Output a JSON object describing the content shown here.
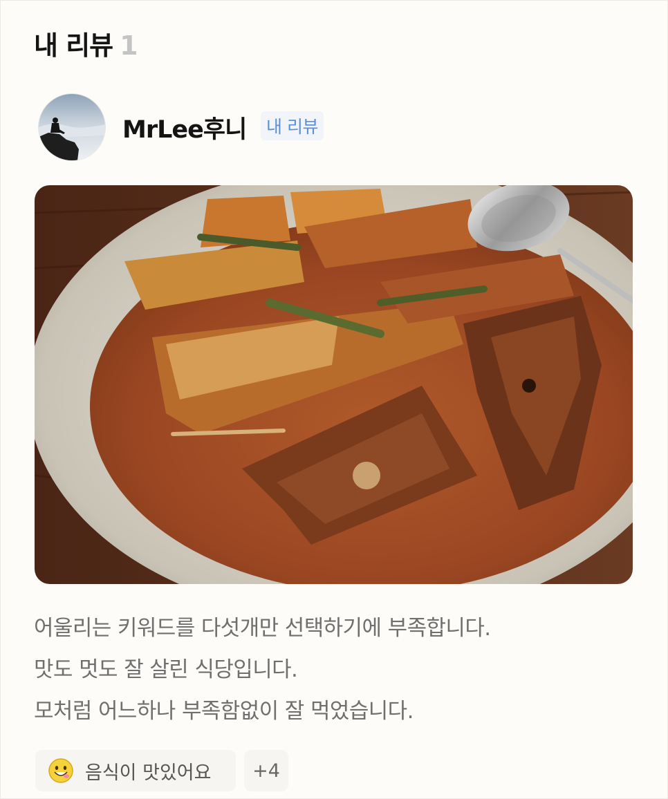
{
  "section": {
    "title": "내 리뷰",
    "count": "1"
  },
  "reviewer": {
    "name": "MrLee후니",
    "badge": "내 리뷰",
    "avatar_icon": "profile-photo"
  },
  "review": {
    "photo_icon": "food-photo",
    "text_lines": [
      "어울리는 키워드를 다섯개만 선택하기에 부족합니다.",
      "맛도 멋도 잘 살린 식당입니다.",
      "모처럼 어느하나 부족함없이 잘 먹었습니다."
    ],
    "keyword_chip": {
      "icon": "smiley-face-icon",
      "label": "음식이 맛있어요"
    },
    "more_chip": "+4"
  },
  "colors": {
    "badge_text": "#5b8fd6",
    "count_text": "#c4c4c4",
    "body_text": "#6f6f6f"
  }
}
